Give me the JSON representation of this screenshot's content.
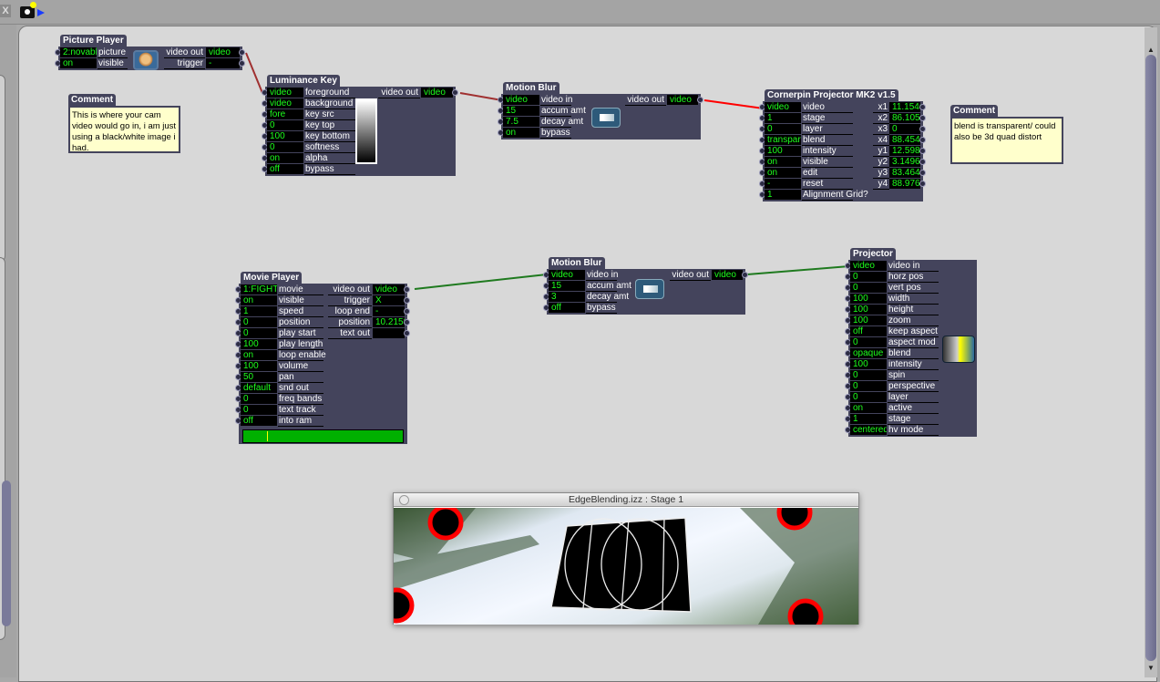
{
  "toolbar": {
    "close_label": "X",
    "snapshot_icon": "camera-icon",
    "run_icon": "play-icon"
  },
  "wire_colors": {
    "video_red": "#a03030",
    "selected_red": "#ff0000",
    "green": "#1f7a1f"
  },
  "actors": [
    {
      "id": "picture-player",
      "title": "Picture Player",
      "icon": "picture-thumbnail-icon",
      "inputs": [
        {
          "value": "2:novabl",
          "label": "picture"
        },
        {
          "value": "on",
          "label": "visible"
        }
      ],
      "outputs": [
        {
          "label": "video out",
          "value": "video"
        },
        {
          "label": "trigger",
          "value": "-"
        }
      ]
    },
    {
      "id": "luminance-key",
      "title": "Luminance Key",
      "icon": "luminance-gradient-icon",
      "inputs": [
        {
          "value": "video",
          "label": "foreground"
        },
        {
          "value": "video",
          "label": "background"
        },
        {
          "value": "fore",
          "label": "key src"
        },
        {
          "value": "0",
          "label": "key top"
        },
        {
          "value": "100",
          "label": "key bottom"
        },
        {
          "value": "0",
          "label": "softness"
        },
        {
          "value": "on",
          "label": "alpha"
        },
        {
          "value": "off",
          "label": "bypass"
        }
      ],
      "outputs": [
        {
          "label": "video out",
          "value": "video"
        }
      ]
    },
    {
      "id": "motion-blur-1",
      "title": "Motion Blur",
      "icon": "motion-blur-icon",
      "inputs": [
        {
          "value": "video",
          "label": "video in"
        },
        {
          "value": "15",
          "label": "accum amt"
        },
        {
          "value": "7.5",
          "label": "decay amt"
        },
        {
          "value": "on",
          "label": "bypass"
        }
      ],
      "outputs": [
        {
          "label": "video out",
          "value": "video"
        }
      ]
    },
    {
      "id": "cornerpin-projector",
      "title": "Cornerpin Projector MK2 v1.5",
      "icon": "",
      "inputs": [
        {
          "value": "video",
          "label": "video"
        },
        {
          "value": "1",
          "label": "stage"
        },
        {
          "value": "0",
          "label": "layer"
        },
        {
          "value": "transpar",
          "label": "blend"
        },
        {
          "value": "100",
          "label": "intensity"
        },
        {
          "value": "on",
          "label": "visible"
        },
        {
          "value": "on",
          "label": "edit"
        },
        {
          "value": "-",
          "label": "reset"
        },
        {
          "value": "1",
          "label": "Alignment Grid?"
        }
      ],
      "outputs": [
        {
          "label": "x1",
          "value": "11.1546"
        },
        {
          "label": "x2",
          "value": "86.1057"
        },
        {
          "label": "x3",
          "value": "0"
        },
        {
          "label": "x4",
          "value": "88.454"
        },
        {
          "label": "y1",
          "value": "12.5984"
        },
        {
          "label": "y2",
          "value": "3.1496"
        },
        {
          "label": "y3",
          "value": "83.4646"
        },
        {
          "label": "y4",
          "value": "88.9764"
        }
      ]
    },
    {
      "id": "movie-player",
      "title": "Movie Player",
      "icon": "",
      "inputs": [
        {
          "value": "1:FIGHT",
          "label": "movie"
        },
        {
          "value": "on",
          "label": "visible"
        },
        {
          "value": "1",
          "label": "speed"
        },
        {
          "value": "0",
          "label": "position"
        },
        {
          "value": "0",
          "label": "play start"
        },
        {
          "value": "100",
          "label": "play length"
        },
        {
          "value": "on",
          "label": "loop enable"
        },
        {
          "value": "100",
          "label": "volume"
        },
        {
          "value": "50",
          "label": "pan"
        },
        {
          "value": "default",
          "label": "snd out"
        },
        {
          "value": "0",
          "label": "freq bands"
        },
        {
          "value": "0",
          "label": "text track"
        },
        {
          "value": "off",
          "label": "into ram"
        }
      ],
      "outputs": [
        {
          "label": "video out",
          "value": "video"
        },
        {
          "label": "trigger",
          "value": "X"
        },
        {
          "label": "loop end",
          "value": "-"
        },
        {
          "label": "position",
          "value": "10.2158"
        },
        {
          "label": "text out",
          "value": ""
        }
      ],
      "progress": 0.15
    },
    {
      "id": "motion-blur-2",
      "title": "Motion Blur",
      "icon": "motion-blur-icon",
      "inputs": [
        {
          "value": "video",
          "label": "video in"
        },
        {
          "value": "15",
          "label": "accum amt"
        },
        {
          "value": "3",
          "label": "decay amt"
        },
        {
          "value": "off",
          "label": "bypass"
        }
      ],
      "outputs": [
        {
          "label": "video out",
          "value": "video"
        }
      ]
    },
    {
      "id": "projector",
      "title": "Projector",
      "icon": "projector-icon",
      "inputs": [
        {
          "value": "video",
          "label": "video in"
        },
        {
          "value": "0",
          "label": "horz pos"
        },
        {
          "value": "0",
          "label": "vert pos"
        },
        {
          "value": "100",
          "label": "width"
        },
        {
          "value": "100",
          "label": "height"
        },
        {
          "value": "100",
          "label": "zoom"
        },
        {
          "value": "off",
          "label": "keep aspect"
        },
        {
          "value": "0",
          "label": "aspect mod"
        },
        {
          "value": "opaque",
          "label": "blend"
        },
        {
          "value": "100",
          "label": "intensity"
        },
        {
          "value": "0",
          "label": "spin"
        },
        {
          "value": "0",
          "label": "perspective"
        },
        {
          "value": "0",
          "label": "layer"
        },
        {
          "value": "on",
          "label": "active"
        },
        {
          "value": "1",
          "label": "stage"
        },
        {
          "value": "centered",
          "label": "hv mode"
        }
      ],
      "outputs": []
    }
  ],
  "comments": [
    {
      "title": "Comment",
      "text": "This is where your cam video would go in, i am just using a black/white image i had."
    },
    {
      "title": "Comment",
      "text": "blend is transparent/ could also be 3d quad distort"
    }
  ],
  "stage_window": {
    "title": "EdgeBlending.izz : Stage 1"
  }
}
